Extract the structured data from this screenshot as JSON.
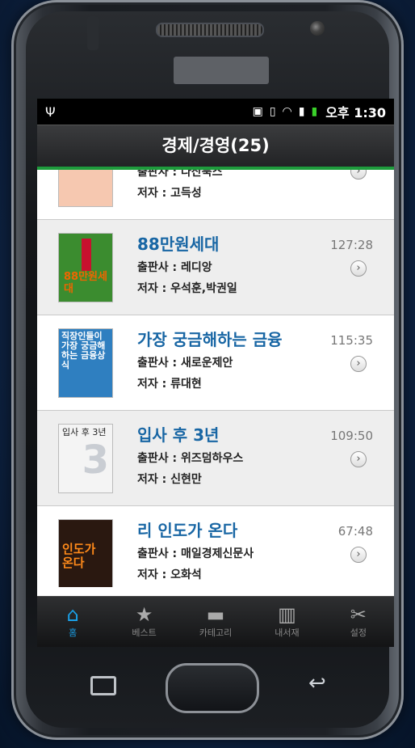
{
  "status_bar": {
    "time": "오후 1:30",
    "icons": [
      "usb-icon",
      "wifi-icon",
      "signal-icon",
      "battery-icon"
    ]
  },
  "header": {
    "title": "경제/경영(25)"
  },
  "books": [
    {
      "title": "",
      "publisher": "출판사 : 다산북스",
      "author": "저자 : 고득성",
      "duration": ""
    },
    {
      "title": "88만원세대",
      "publisher": "출판사 : 레디앙",
      "author": "저자 : 우석훈,박권일",
      "duration": "127:28",
      "cover_text": "88만원세대"
    },
    {
      "title": "가장 궁금해하는 금융",
      "publisher": "출판사 : 새로운제안",
      "author": "저자 : 류대현",
      "duration": "115:35",
      "cover_text": "직장인들이 가장 궁금해하는 금융상식"
    },
    {
      "title": "입사 후 3년",
      "publisher": "출판사 : 위즈덤하우스",
      "author": "저자 : 신현만",
      "duration": "109:50",
      "cover_text": "입사 후 3년"
    },
    {
      "title": "리 인도가 온다",
      "publisher": "출판사 : 매일경제신문사",
      "author": "저자 : 오화석",
      "duration": "67:48",
      "cover_text": "인도가 온다"
    }
  ],
  "tabs": [
    {
      "label": "홈",
      "icon": "home-icon",
      "active": true
    },
    {
      "label": "베스트",
      "icon": "star-icon",
      "active": false
    },
    {
      "label": "카테고리",
      "icon": "folder-icon",
      "active": false
    },
    {
      "label": "내서재",
      "icon": "bookshelf-icon",
      "active": false
    },
    {
      "label": "설정",
      "icon": "wrench-icon",
      "active": false
    }
  ],
  "colors": {
    "accent": "#1aa0e8",
    "title_blue": "#1866a4",
    "divider_green": "#1e9b3c"
  }
}
